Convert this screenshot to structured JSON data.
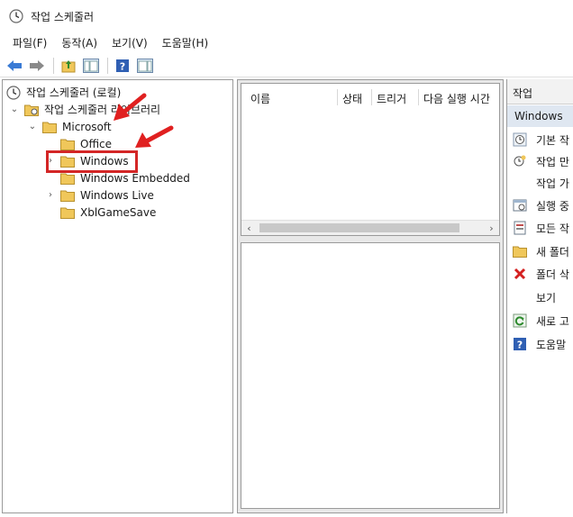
{
  "window": {
    "title": "작업 스케줄러"
  },
  "menu": [
    {
      "label": "파일(F)"
    },
    {
      "label": "동작(A)"
    },
    {
      "label": "보기(V)"
    },
    {
      "label": "도움말(H)"
    }
  ],
  "toolbar": {
    "buttons": [
      "back-arrow-icon",
      "forward-arrow-icon",
      "folder-up-icon",
      "console-tree-icon",
      "help-icon",
      "action-pane-icon"
    ]
  },
  "tree": {
    "root": "작업 스케줄러 (로컬)",
    "library": "작업 스케줄러 라이브러리",
    "microsoft": "Microsoft",
    "office": "Office",
    "windows": "Windows",
    "windows_embedded": "Windows Embedded",
    "windows_live": "Windows Live",
    "xbl": "XblGameSave"
  },
  "list": {
    "columns": [
      "이름",
      "상태",
      "트리거",
      "다음 실행 시간"
    ]
  },
  "actions": {
    "header": "작업",
    "selected": "Windows",
    "items": [
      {
        "label": "기본 작",
        "icon": "clock-task-icon"
      },
      {
        "label": "작업 만",
        "icon": "create-task-icon"
      },
      {
        "label": "작업 가",
        "icon": ""
      },
      {
        "label": "실행 중",
        "icon": "running-tasks-icon"
      },
      {
        "label": "모든 작",
        "icon": "all-tasks-icon"
      },
      {
        "label": "새 폴더",
        "icon": "new-folder-icon"
      },
      {
        "label": "폴더 삭",
        "icon": "delete-icon"
      },
      {
        "label": "보기",
        "icon": ""
      },
      {
        "label": "새로 고",
        "icon": "refresh-icon"
      },
      {
        "label": "도움말",
        "icon": "help-icon"
      }
    ]
  },
  "colors": {
    "highlight_border": "#d32626",
    "arrow": "#e02020",
    "selected_bg": "#dfe7f1",
    "folder": "#f0c75a"
  }
}
